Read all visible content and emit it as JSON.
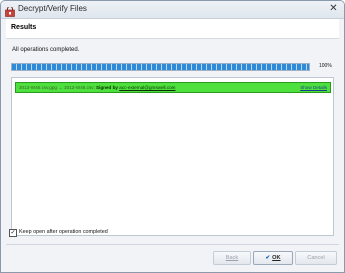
{
  "window": {
    "title": "Decrypt/Verify Files",
    "close_glyph": "✕"
  },
  "header": {
    "title": "Results"
  },
  "status": {
    "message": "All operations completed."
  },
  "progress": {
    "value_percent": 100,
    "label": "100%"
  },
  "results": [
    {
      "files": "2013-W46.csv.gpg → 2013-W46.csv:",
      "signed_label": "Signed by",
      "signer": "acc-external@gmswell.com",
      "details_link": "Show Details",
      "status_color": "#4ee03c"
    }
  ],
  "options": {
    "keep_open_label": "Keep open after operation completed",
    "keep_open_checked": true,
    "check_glyph": "✓"
  },
  "buttons": {
    "back_label": "Back",
    "ok_label": "OK",
    "ok_icon": "✔",
    "cancel_label": "Cancel"
  },
  "icons": {
    "app": "app-icon",
    "close": "close-icon",
    "ok": "checkmark-icon"
  }
}
